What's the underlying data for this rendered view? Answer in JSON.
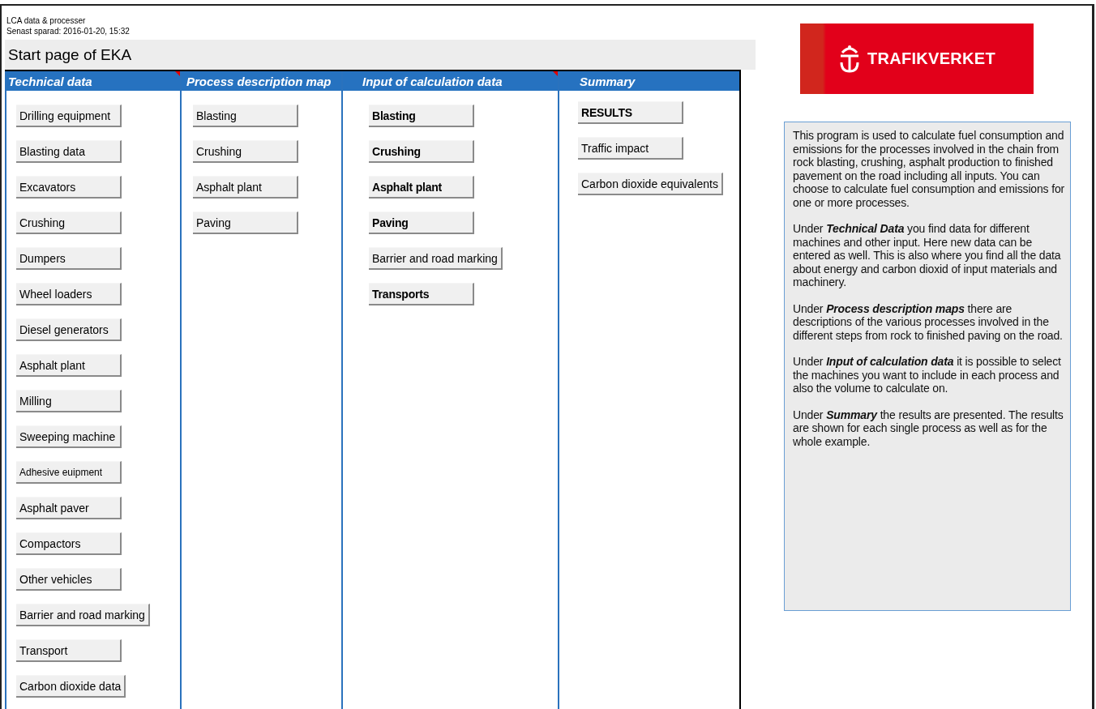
{
  "file_info": {
    "name": "LCA data & processer",
    "saved": "Senast sparad:  2016-01-20, 15:32"
  },
  "page_title": "Start page of EKA",
  "columns": [
    {
      "heading": "Technical data",
      "has_comment": true,
      "buttons": [
        {
          "label": "Drilling equipment",
          "kind": "plain"
        },
        {
          "label": "Blasting data",
          "kind": "plain"
        },
        {
          "label": "Excavators",
          "kind": "plain"
        },
        {
          "label": "Crushing",
          "kind": "plain"
        },
        {
          "label": "Dumpers",
          "kind": "plain"
        },
        {
          "label": "Wheel loaders",
          "kind": "plain"
        },
        {
          "label": "Diesel generators",
          "kind": "plain"
        },
        {
          "label": "Asphalt plant",
          "kind": "plain"
        },
        {
          "label": "Milling",
          "kind": "plain"
        },
        {
          "label": "Sweeping machine",
          "kind": "plain"
        },
        {
          "label": "Adhesive euipment",
          "kind": "small"
        },
        {
          "label": "Asphalt paver",
          "kind": "plain"
        },
        {
          "label": "Compactors",
          "kind": "plain"
        },
        {
          "label": "Other vehicles",
          "kind": "plain"
        },
        {
          "label": "Barrier and road marking",
          "kind": "plain"
        },
        {
          "label": "Transport",
          "kind": "plain"
        },
        {
          "label": "Carbon dioxide data",
          "kind": "plain"
        }
      ]
    },
    {
      "heading": "Process description map",
      "has_comment": false,
      "buttons": [
        {
          "label": "Blasting",
          "kind": "plain"
        },
        {
          "label": "Crushing",
          "kind": "plain"
        },
        {
          "label": "Asphalt plant",
          "kind": "plain"
        },
        {
          "label": "Paving",
          "kind": "plain"
        }
      ]
    },
    {
      "heading": "Input of calculation data",
      "has_comment": true,
      "buttons": [
        {
          "label": "Blasting",
          "kind": "bold"
        },
        {
          "label": "Crushing",
          "kind": "bold"
        },
        {
          "label": "Asphalt plant",
          "kind": "bold"
        },
        {
          "label": "Paving",
          "kind": "bold"
        },
        {
          "label": "Barrier and road marking",
          "kind": "plain"
        },
        {
          "label": "Transports",
          "kind": "bold"
        }
      ]
    },
    {
      "heading": "Summary",
      "has_comment": false,
      "buttons": [
        {
          "label": "RESULTS",
          "kind": "bold"
        },
        {
          "label": "Traffic impact",
          "kind": "plain"
        },
        {
          "label": "Carbon dioxide equivalents",
          "kind": "plain"
        }
      ]
    }
  ],
  "logo": {
    "text": "TRAFIKVERKET"
  },
  "info_box": {
    "paragraphs": [
      "This program is used to calculate fuel consumption and emissions for the processes involved in the chain from rock blasting, crushing, asphalt production to finished pavement on the road including all inputs. You can choose to calculate fuel consumption and emissions for one or more processes.",
      "Under **Technical Data** you find data for different machines and other input. Here new data can  be entered as well. This is also where you find all the data about energy and carbon dioxid of input materials and machinery.",
      "Under **Process description maps** there are descriptions of the various processes involved in the different steps from rock to finished paving on the road.",
      "Under **Input of calculation data**  it is possible to select the machines you want to include in each process and also the volume to calculate on.",
      "Under **Summary** the results are presented. The results are shown for each single process as well as for the whole example."
    ]
  }
}
